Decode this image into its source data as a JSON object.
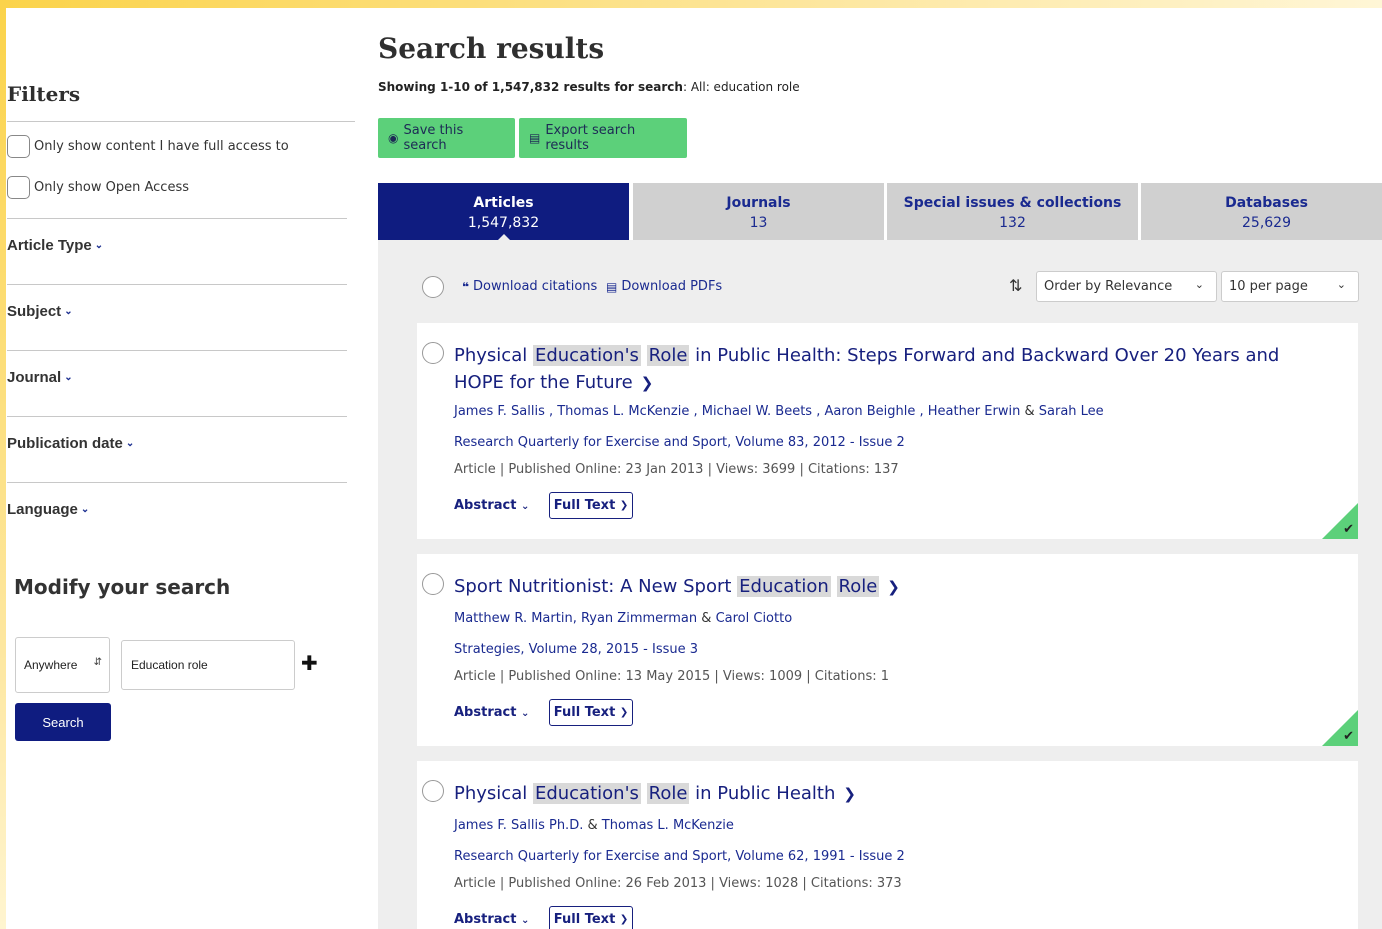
{
  "sidebar": {
    "filters_title": "Filters",
    "checkboxes": [
      "Only show content I have full access to",
      "Only show Open Access"
    ],
    "facets": [
      "Article Type",
      "Subject",
      "Journal",
      "Publication date",
      "Language"
    ],
    "modify_title": "Modify your search",
    "scope_value": "Anywhere",
    "term_value": "Education role",
    "search_label": "Search"
  },
  "header": {
    "title": "Search results",
    "showing_bold": "Showing 1-10 of 1,547,832 results for search",
    "showing_rest": ": All: education role",
    "save_label": "Save this search",
    "export_label": "Export search results"
  },
  "tabs": [
    {
      "label": "Articles",
      "count": "1,547,832"
    },
    {
      "label": "Journals",
      "count": "13"
    },
    {
      "label": "Special issues & collections",
      "count": "132"
    },
    {
      "label": "Databases",
      "count": "25,629"
    }
  ],
  "toolbar": {
    "download_citations": "Download citations",
    "download_pdfs": "Download PDFs",
    "order_value": "Order by Relevance",
    "per_page_value": "10 per page"
  },
  "results": [
    {
      "title_parts": [
        "Physical ",
        "Education's",
        " ",
        "Role",
        " in Public Health: Steps Forward and Backward Over 20 Years and HOPE for the Future"
      ],
      "authors": [
        "James F. Sallis , Thomas L. McKenzie , Michael W. Beets , Aaron Beighle , Heather Erwin",
        "&",
        "Sarah Lee"
      ],
      "journal": "Research Quarterly for Exercise and Sport, Volume 83, 2012 - Issue 2",
      "meta": "Article | Published Online: 23 Jan 2013 | Views: 3699 | Citations: 137",
      "abstract_label": "Abstract",
      "fulltext_label": "Full Text"
    },
    {
      "title_parts": [
        "Sport Nutritionist: A New Sport ",
        "Education",
        " ",
        "Role",
        ""
      ],
      "authors": [
        "Matthew R. Martin, Ryan Zimmerman",
        "&",
        "Carol Ciotto"
      ],
      "journal": "Strategies, Volume 28, 2015 - Issue 3",
      "meta": "Article | Published Online: 13 May 2015 | Views: 1009 | Citations: 1",
      "abstract_label": "Abstract",
      "fulltext_label": "Full Text"
    },
    {
      "title_parts": [
        "Physical ",
        "Education's",
        " ",
        "Role",
        " in Public Health"
      ],
      "authors": [
        "James F. Sallis Ph.D.",
        "&",
        "Thomas L. McKenzie"
      ],
      "journal": "Research Quarterly for Exercise and Sport, Volume 62, 1991 - Issue 2",
      "meta": "Article | Published Online: 26 Feb 2013 | Views: 1028 | Citations: 373",
      "abstract_label": "Abstract",
      "fulltext_label": "Full Text"
    }
  ],
  "colors": {
    "brand": "#0f1c80",
    "accent": "#5cd07a",
    "link": "#1a2a90"
  }
}
